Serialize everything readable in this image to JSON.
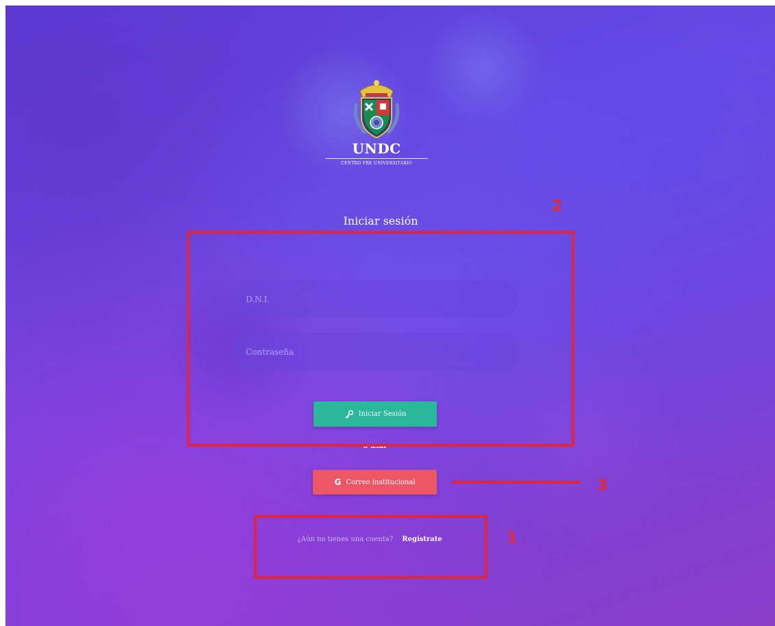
{
  "branding": {
    "logo_title": "UNDC",
    "logo_subtitle": "CENTRO PRE UNIVERSITARIO",
    "crest_icon": "university-crest-icon"
  },
  "login": {
    "title": "Iniciar sesión",
    "dni_placeholder": "D.N.I.",
    "password_placeholder": "Contraseña",
    "submit_label": "Iniciar Sesión",
    "submit_icon": "key-icon",
    "or_text": "o usar",
    "google_label": "Correo institucional",
    "google_icon": "google-icon"
  },
  "register": {
    "question": "¿Aún no tienes una cuenta?",
    "link_label": "Regístrate"
  },
  "annotations": {
    "box_2_label": "2",
    "line_3_label": "3",
    "box_1_label": "1",
    "color": "#e0253f"
  },
  "colors": {
    "background": "#6a46e0",
    "login_button": "#2bb79a",
    "google_button": "#ec5766"
  }
}
